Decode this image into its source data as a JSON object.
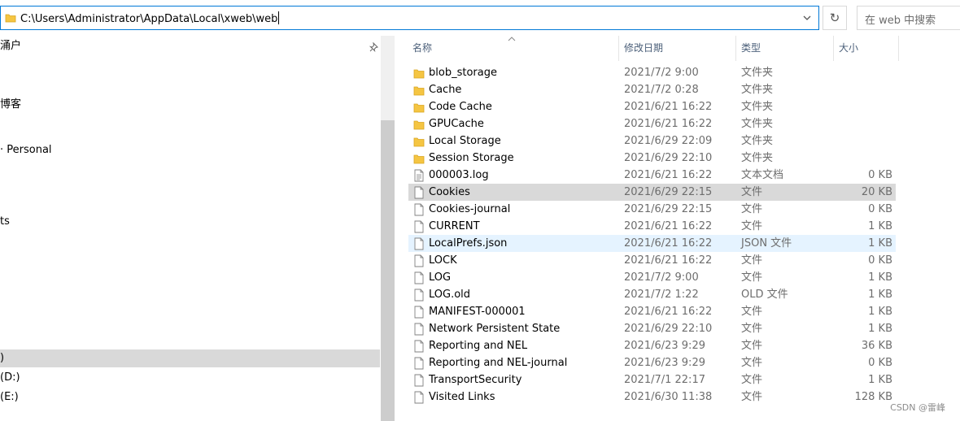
{
  "address": {
    "path": "C:\\Users\\Administrator\\AppData\\Local\\xweb\\web",
    "search_placeholder": "在 web 中搜索"
  },
  "nav": {
    "items": [
      {
        "label": "涌户",
        "selected": false
      },
      {
        "label": "博客",
        "selected": false
      },
      {
        "label": "· Personal",
        "selected": false
      },
      {
        "label": "ts",
        "selected": false
      },
      {
        "label": ")",
        "selected": true
      },
      {
        "label": "(D:)",
        "selected": false
      },
      {
        "label": "(E:)",
        "selected": false
      }
    ]
  },
  "columns": {
    "name": "名称",
    "date": "修改日期",
    "type": "类型",
    "size": "大小"
  },
  "files": [
    {
      "name": "blob_storage",
      "date": "2021/7/2 9:00",
      "type": "文件夹",
      "size": "",
      "kind": "folder",
      "state": ""
    },
    {
      "name": "Cache",
      "date": "2021/7/2 0:28",
      "type": "文件夹",
      "size": "",
      "kind": "folder",
      "state": ""
    },
    {
      "name": "Code Cache",
      "date": "2021/6/21 16:22",
      "type": "文件夹",
      "size": "",
      "kind": "folder",
      "state": ""
    },
    {
      "name": "GPUCache",
      "date": "2021/6/21 16:22",
      "type": "文件夹",
      "size": "",
      "kind": "folder",
      "state": ""
    },
    {
      "name": "Local Storage",
      "date": "2021/6/29 22:09",
      "type": "文件夹",
      "size": "",
      "kind": "folder",
      "state": ""
    },
    {
      "name": "Session Storage",
      "date": "2021/6/29 22:10",
      "type": "文件夹",
      "size": "",
      "kind": "folder",
      "state": ""
    },
    {
      "name": "000003.log",
      "date": "2021/6/21 16:22",
      "type": "文本文档",
      "size": "0 KB",
      "kind": "text",
      "state": ""
    },
    {
      "name": "Cookies",
      "date": "2021/6/29 22:15",
      "type": "文件",
      "size": "20 KB",
      "kind": "file",
      "state": "selected"
    },
    {
      "name": "Cookies-journal",
      "date": "2021/6/29 22:15",
      "type": "文件",
      "size": "0 KB",
      "kind": "file",
      "state": ""
    },
    {
      "name": "CURRENT",
      "date": "2021/6/21 16:22",
      "type": "文件",
      "size": "1 KB",
      "kind": "file",
      "state": ""
    },
    {
      "name": "LocalPrefs.json",
      "date": "2021/6/21 16:22",
      "type": "JSON 文件",
      "size": "1 KB",
      "kind": "file",
      "state": "hover"
    },
    {
      "name": "LOCK",
      "date": "2021/6/21 16:22",
      "type": "文件",
      "size": "0 KB",
      "kind": "file",
      "state": ""
    },
    {
      "name": "LOG",
      "date": "2021/7/2 9:00",
      "type": "文件",
      "size": "1 KB",
      "kind": "file",
      "state": ""
    },
    {
      "name": "LOG.old",
      "date": "2021/7/2 1:22",
      "type": "OLD 文件",
      "size": "1 KB",
      "kind": "file",
      "state": ""
    },
    {
      "name": "MANIFEST-000001",
      "date": "2021/6/21 16:22",
      "type": "文件",
      "size": "1 KB",
      "kind": "file",
      "state": ""
    },
    {
      "name": "Network Persistent State",
      "date": "2021/6/29 22:10",
      "type": "文件",
      "size": "1 KB",
      "kind": "file",
      "state": ""
    },
    {
      "name": "Reporting and NEL",
      "date": "2021/6/23 9:29",
      "type": "文件",
      "size": "36 KB",
      "kind": "file",
      "state": ""
    },
    {
      "name": "Reporting and NEL-journal",
      "date": "2021/6/23 9:29",
      "type": "文件",
      "size": "0 KB",
      "kind": "file",
      "state": ""
    },
    {
      "name": "TransportSecurity",
      "date": "2021/7/1 22:17",
      "type": "文件",
      "size": "1 KB",
      "kind": "file",
      "state": ""
    },
    {
      "name": "Visited Links",
      "date": "2021/6/30 11:38",
      "type": "文件",
      "size": "128 KB",
      "kind": "file",
      "state": ""
    }
  ],
  "watermark": "CSDN @雷峰",
  "colors": {
    "accent": "#0078d7",
    "folder": "#f5c542",
    "selected_row": "#d9d9d9",
    "hover_row": "#e5f3ff",
    "header_text": "#4c607a"
  }
}
